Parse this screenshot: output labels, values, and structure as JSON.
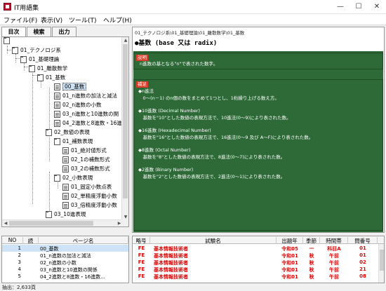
{
  "window": {
    "title": "IT用語集",
    "min": "—",
    "max": "☐",
    "close": "✕"
  },
  "menu": [
    {
      "label": "ファイル(F)"
    },
    {
      "label": "表示(V)"
    },
    {
      "label": "ツール(T)"
    },
    {
      "label": "ヘルプ(H)"
    }
  ],
  "tabs": [
    {
      "label": "目次"
    },
    {
      "label": "検索"
    },
    {
      "label": "出力"
    }
  ],
  "tree": {
    "nodes": [
      {
        "label": "",
        "type": "folder"
      },
      {
        "label": "01_テクノロジ系",
        "type": "folder"
      },
      {
        "label": "01_基礎理論",
        "type": "folder"
      },
      {
        "label": "01_離散数学",
        "type": "folder"
      },
      {
        "label": "01_基数",
        "type": "folder"
      },
      {
        "label": "00_基数",
        "type": "doc"
      },
      {
        "label": "01_n進数の加法と減法",
        "type": "doc"
      },
      {
        "label": "02_n進数の小数",
        "type": "doc"
      },
      {
        "label": "03_n進数と10進数の関",
        "type": "doc"
      },
      {
        "label": "04_2進数と8進数・16進",
        "type": "doc"
      },
      {
        "label": "02_数値の表現",
        "type": "folder"
      },
      {
        "label": "01_補数表現",
        "type": "folder"
      },
      {
        "label": "01_絶対値形式",
        "type": "doc"
      },
      {
        "label": "02_1の補数形式",
        "type": "doc"
      },
      {
        "label": "03_2の補数形式",
        "type": "doc"
      },
      {
        "label": "02_小数表現",
        "type": "folder"
      },
      {
        "label": "01_固定小数点表",
        "type": "doc"
      },
      {
        "label": "02_単精度浮動小数",
        "type": "doc"
      },
      {
        "label": "03_倍精度浮動小数",
        "type": "doc"
      },
      {
        "label": "03_10進表現",
        "type": "folder"
      }
    ]
  },
  "content": {
    "breadcrumb": "01_テクノロジ系\\01_基礎理論\\01_離散数学\\01_基数",
    "heading": "●基数 (base 又は radix)",
    "explain_tag": "説明",
    "explain_text": "n進数の基となる\"n\"で表された数字。",
    "supplement_tag": "補足",
    "supplement": [
      "◆n進法",
      "　0～(n－1) のn個の数をまとめて1つとし、1桁繰り上げる数え方。",
      "",
      "◆10進数 (Decimal Number)",
      "　基数を\"10\"とした数値の表現方法で、10進法(0～9)により表された数。",
      "",
      "◆16進数 (Hexadecimal Number)",
      "　基数を\"16\"とした数値の表現方法で、16進法(0～9 及び A～F)により表された数。",
      "",
      "◆8進数 (Octal Number)",
      "　基数を\"8\"とした数値の表現方法で、8進法(0～7)により表された数。",
      "",
      "◆2進数 (Binary Number)",
      "　基数を\"2\"とした数値の表現方法で、2進法(0～1)により表された数。"
    ]
  },
  "leftList": {
    "headers": [
      "NO",
      "読",
      "ページ名"
    ],
    "rows": [
      {
        "no": "1",
        "page": "00_基数"
      },
      {
        "no": "2",
        "page": "01_n進数の加法と減法"
      },
      {
        "no": "3",
        "page": "02_n進数の小数"
      },
      {
        "no": "4",
        "page": "03_n進数と10進数の関係"
      },
      {
        "no": "5",
        "page": "04_2進数と8進数・16進数..."
      }
    ]
  },
  "rightList": {
    "headers": [
      "略号",
      "試験名",
      "出題年",
      "季節",
      "時間帯",
      "問番号"
    ],
    "rows": [
      {
        "abbr": "FE",
        "exam": "基本情報技術者",
        "year": "令和05",
        "season": "—",
        "time": "科目A",
        "num": "01"
      },
      {
        "abbr": "FE",
        "exam": "基本情報技術者",
        "year": "令和01",
        "season": "秋",
        "time": "午前",
        "num": "01"
      },
      {
        "abbr": "FE",
        "exam": "基本情報技術者",
        "year": "令和01",
        "season": "秋",
        "time": "午前",
        "num": "02"
      },
      {
        "abbr": "FE",
        "exam": "基本情報技術者",
        "year": "令和01",
        "season": "秋",
        "time": "午前",
        "num": "21"
      },
      {
        "abbr": "FE",
        "exam": "基本情報技術者",
        "year": "令和01",
        "season": "秋",
        "time": "午前",
        "num": "08"
      }
    ]
  },
  "status": {
    "text": "抽出：2,633頁"
  },
  "colors": {
    "panel_green": "#2e6a38",
    "tag_red": "#d83c2a",
    "row_red": "#dd0000",
    "selected": "#cfe3f7"
  }
}
